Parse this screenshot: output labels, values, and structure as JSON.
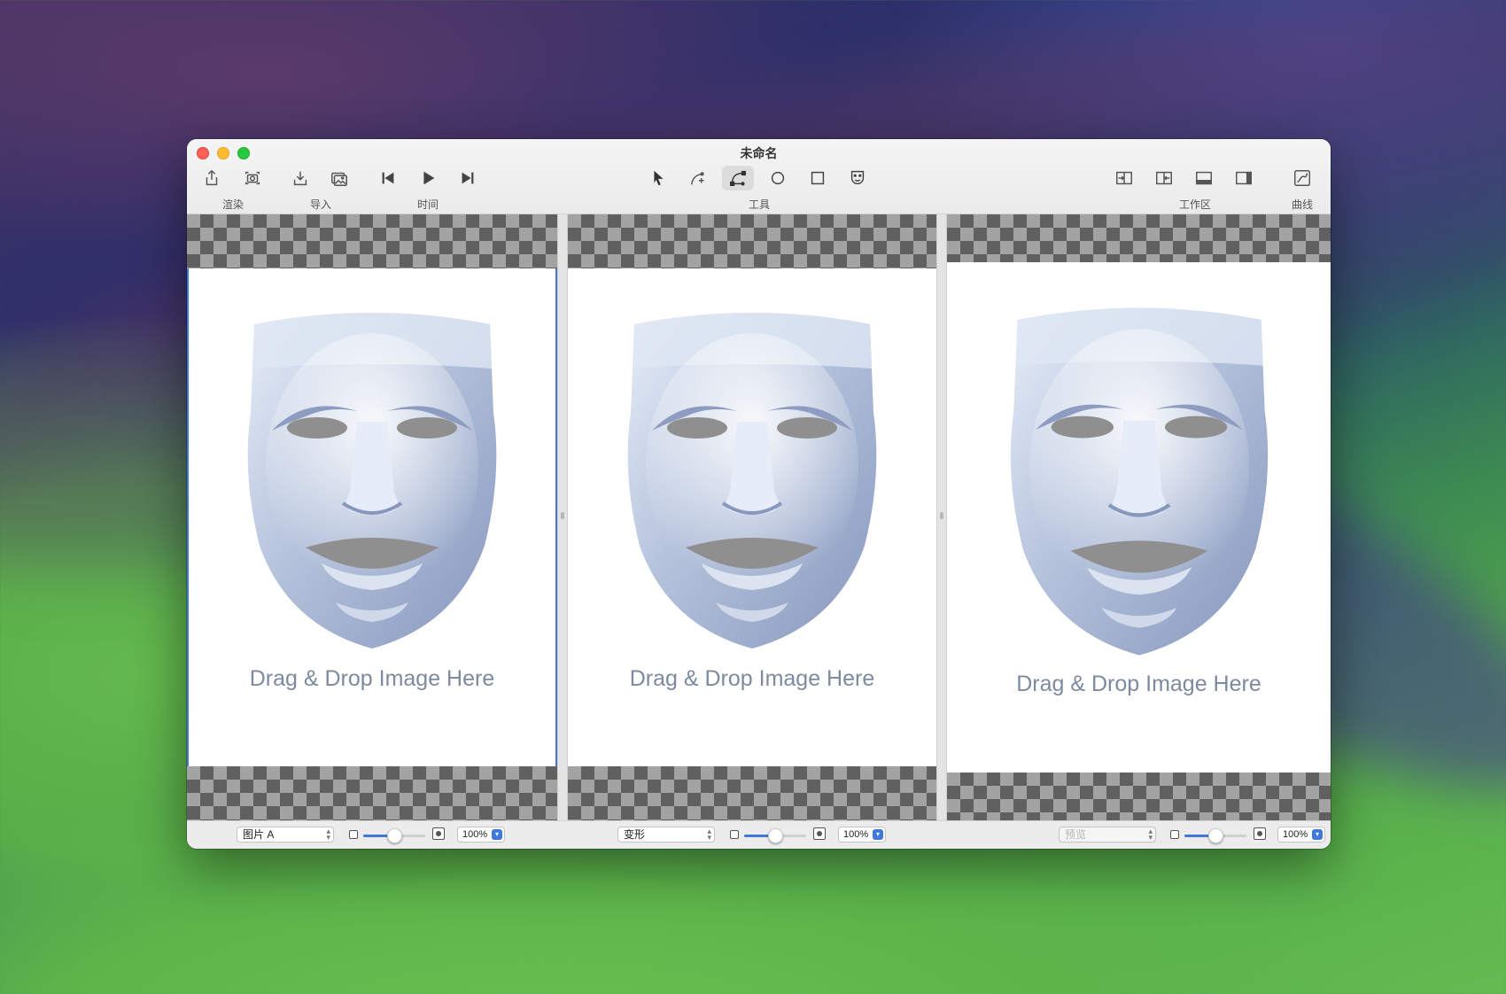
{
  "window": {
    "title": "未命名"
  },
  "toolbar": {
    "groups": {
      "render": "渲染",
      "import": "导入",
      "time": "时间",
      "tools": "工具",
      "workspace": "工作区",
      "curves": "曲线"
    },
    "icons": {
      "share": "share-icon",
      "snapshot": "camera-icon",
      "import_file": "download-icon",
      "import_image": "photo-icon",
      "prev": "skip-back-icon",
      "play": "play-icon",
      "next": "skip-forward-icon",
      "select": "arrow-pointer-icon",
      "pen_add": "pen-add-icon",
      "bezier": "bezier-curve-icon",
      "ellipse": "circle-icon",
      "rect": "square-icon",
      "face": "face-icon",
      "ws1": "panel-import-icon",
      "ws2": "panel-export-icon",
      "ws3": "panel-bottom-icon",
      "ws4": "panel-right-icon",
      "curve": "chart-curve-icon"
    },
    "active_tool": "bezier"
  },
  "panes": [
    {
      "drop_text": "Drag & Drop Image Here",
      "select_value": "图片 A",
      "select_disabled": false,
      "zoom": "100%",
      "slider_value": 0.5,
      "selected": true
    },
    {
      "drop_text": "Drag & Drop Image Here",
      "select_value": "变形",
      "select_disabled": false,
      "zoom": "100%",
      "slider_value": 0.5,
      "selected": false
    },
    {
      "drop_text": "Drag & Drop Image Here",
      "select_value": "预览",
      "select_disabled": true,
      "zoom": "100%",
      "slider_value": 0.5,
      "selected": false
    }
  ],
  "colors": {
    "accent": "#3f78d8",
    "close": "#fe5f57",
    "minimize": "#febc2e",
    "maximize": "#28c840",
    "drop_text": "#7e8aa0"
  }
}
